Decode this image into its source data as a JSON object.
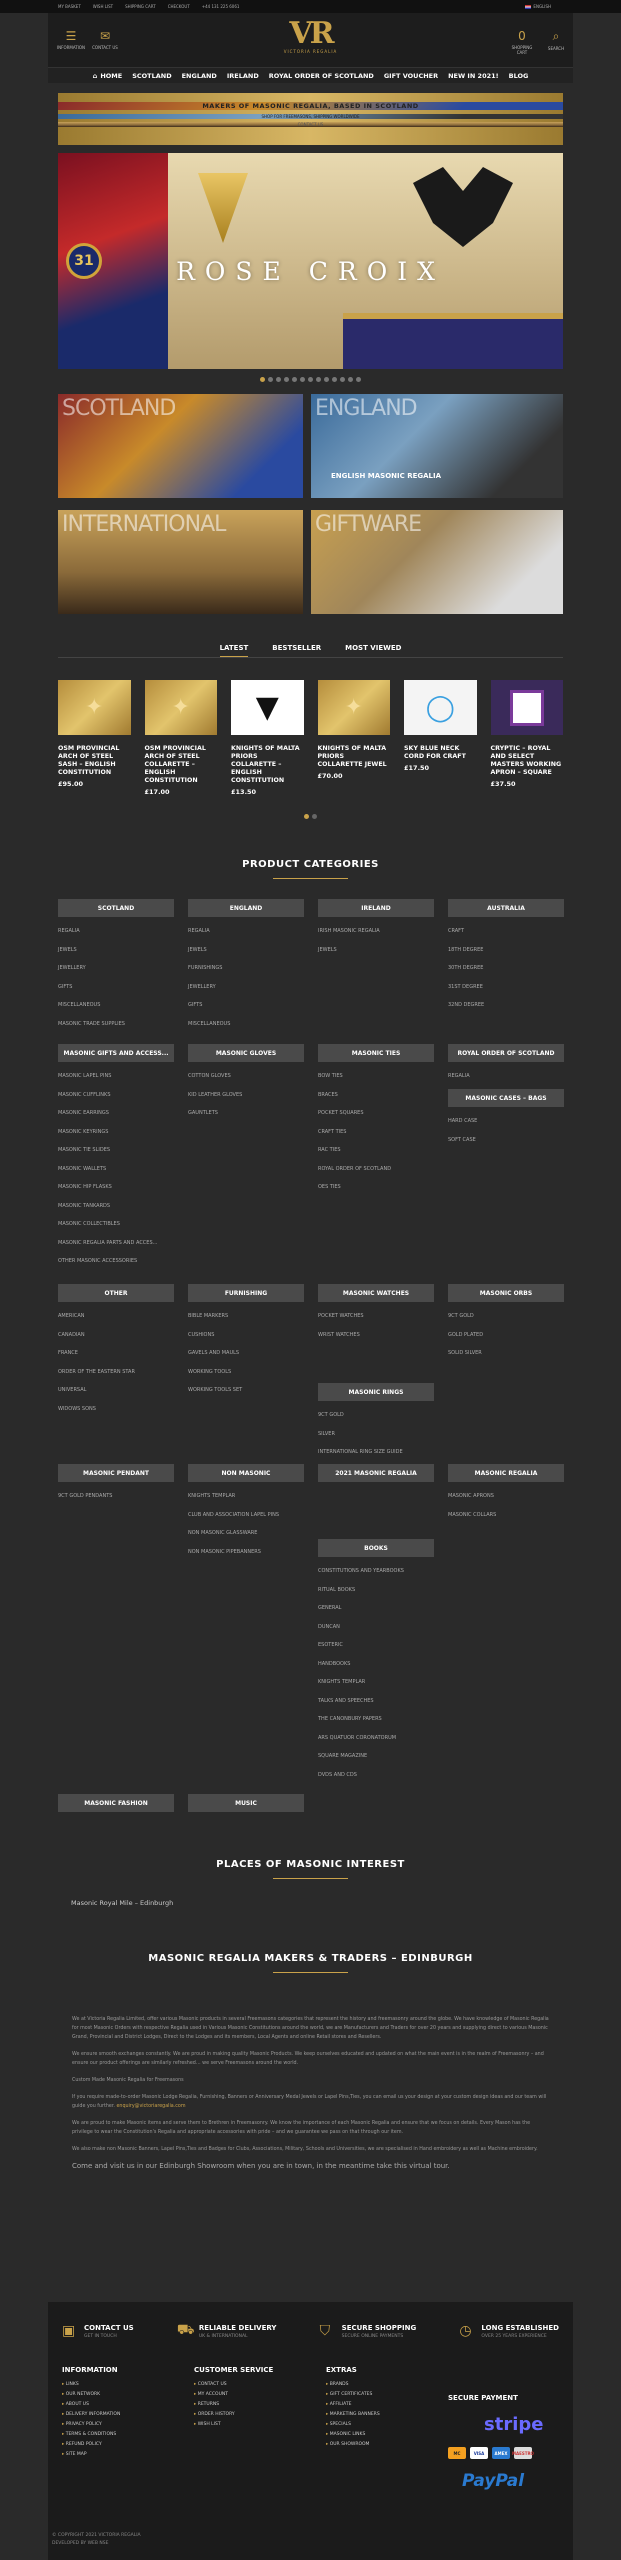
{
  "topbar": {
    "items": [
      "MY BASKET",
      "WISH LIST",
      "SHIPPING CART",
      "CHECKOUT",
      "+44 131 225 6061"
    ],
    "language": "ENGLISH"
  },
  "header": {
    "info_label": "INFORMATION",
    "contact_label": "CONTACT US",
    "logo_text": "VR",
    "logo_sub": "VICTORIA REGALIA",
    "cart_count": "0",
    "cart_label": "SHOPPING CART",
    "search_label": "SEARCH"
  },
  "nav": [
    "HOME",
    "SCOTLAND",
    "ENGLAND",
    "IRELAND",
    "ROYAL ORDER OF SCOTLAND",
    "GIFT VOUCHER",
    "NEW IN 2021!",
    "BLOG"
  ],
  "banner": {
    "title": "MAKERS OF MASONIC REGALIA, BASED IN SCOTLAND",
    "subtitle": "SHOP FOR FREEMASONS, SHIPPING WORLDWIDE",
    "small": "CONTACT US"
  },
  "hero": {
    "caption": "ROSE CROIX",
    "medal": "31",
    "slides": 13,
    "active": 0
  },
  "tiles": [
    {
      "title": "SCOTLAND",
      "caption": ""
    },
    {
      "title": "ENGLAND",
      "caption": "ENGLISH MASONIC REGALIA"
    },
    {
      "title": "INTERNATIONAL",
      "caption": ""
    },
    {
      "title": "GIFTWARE",
      "caption": ""
    }
  ],
  "tabs": [
    "LATEST",
    "BESTSELLER",
    "MOST VIEWED"
  ],
  "products": [
    {
      "name": "OSM PROVINCIAL ARCH OF STEEL SASH – ENGLISH CONSTITUTION",
      "price": "£95.00"
    },
    {
      "name": "OSM PROVINCIAL ARCH OF STEEL COLLARETTE – ENGLISH CONSTITUTION",
      "price": "£17.00"
    },
    {
      "name": "KNIGHTS OF MALTA PRIORS COLLARETTE – ENGLISH CONSTITUTION",
      "price": "£13.50"
    },
    {
      "name": "KNIGHTS OF MALTA PRIORS COLLARETTE JEWEL",
      "price": "£70.00"
    },
    {
      "name": "SKY BLUE NECK CORD FOR CRAFT",
      "price": "£17.50"
    },
    {
      "name": "CRYPTIC – ROYAL AND SELECT MASTERS WORKING APRON – SQUARE",
      "price": "£37.50"
    }
  ],
  "categories_title": "PRODUCT CATEGORIES",
  "categories": [
    {
      "title": "SCOTLAND",
      "items": [
        "REGALIA",
        "JEWELS",
        "JEWELLERY",
        "GIFTS",
        "MISCELLANEOUS",
        "MASONIC TRADE SUPPLIES"
      ]
    },
    {
      "title": "ENGLAND",
      "items": [
        "REGALIA",
        "JEWELS",
        "FURNISHINGS",
        "JEWELLERY",
        "GIFTS",
        "MISCELLANEOUS"
      ]
    },
    {
      "title": "IRELAND",
      "items": [
        "IRISH MASONIC REGALIA",
        "JEWELS"
      ]
    },
    {
      "title": "AUSTRALIA",
      "items": [
        "CRAFT",
        "18TH DEGREE",
        "30TH DEGREE",
        "31ST DEGREE",
        "32ND DEGREE"
      ]
    },
    {
      "title": "MASONIC GIFTS AND ACCESS...",
      "items": [
        "MASONIC LAPEL PINS",
        "MASONIC CUFFLINKS",
        "MASONIC EARRINGS",
        "MASONIC KEYRINGS",
        "MASONIC TIE SLIDES",
        "MASONIC WALLETS",
        "MASONIC HIP FLASKS",
        "MASONIC TANKARDS",
        "MASONIC COLLECTIBLES",
        "MASONIC REGALIA PARTS AND ACCES...",
        "OTHER MASONIC ACCESSORIES"
      ]
    },
    {
      "title": "MASONIC GLOVES",
      "items": [
        "COTTON GLOVES",
        "KID LEATHER GLOVES",
        "GAUNTLETS"
      ]
    },
    {
      "title": "MASONIC TIES",
      "items": [
        "BOW TIES",
        "BRACES",
        "POCKET SQUARES",
        "CRAFT TIES",
        "RAC TIES",
        "ROYAL ORDER OF SCOTLAND",
        "OES TIES"
      ]
    },
    {
      "title": "ROYAL ORDER OF SCOTLAND",
      "items": [
        "REGALIA"
      ]
    },
    {
      "title": "MASONIC CASES – BAGS",
      "items": [
        "HARD CASE",
        "SOFT CASE"
      ]
    },
    {
      "title": "OTHER",
      "items": [
        "AMERICAN",
        "CANADIAN",
        "FRANCE",
        "ORDER OF THE EASTERN STAR",
        "UNIVERSAL",
        "WIDOWS SONS"
      ]
    },
    {
      "title": "FURNISHING",
      "items": [
        "BIBLE MARKERS",
        "CUSHIONS",
        "GAVELS AND MAULS",
        "WORKING TOOLS",
        "WORKING TOOLS SET"
      ]
    },
    {
      "title": "MASONIC WATCHES",
      "items": [
        "POCKET WATCHES",
        "WRIST WATCHES"
      ]
    },
    {
      "title": "MASONIC ORBS",
      "items": [
        "9CT GOLD",
        "GOLD PLATED",
        "SOLID SILVER"
      ]
    },
    {
      "title": "MASONIC RINGS",
      "items": [
        "9CT GOLD",
        "SILVER",
        "INTERNATIONAL RING SIZE GUIDE"
      ]
    },
    {
      "title": "MASONIC PENDANT",
      "items": [
        "9CT GOLD PENDANTS"
      ]
    },
    {
      "title": "NON MASONIC",
      "items": [
        "KNIGHTS TEMPLAR",
        "CLUB AND ASSOCIATION LAPEL PINS",
        "NON MASONIC GLASSWARE",
        "NON MASONIC PIPEBANNERS"
      ]
    },
    {
      "title": "2021 MASONIC REGALIA",
      "items": []
    },
    {
      "title": "MASONIC REGALIA",
      "items": [
        "MASONIC APRONS",
        "MASONIC COLLARS"
      ]
    },
    {
      "title": "BOOKS",
      "items": [
        "CONSTITUTIONS AND YEARBOOKS",
        "RITUAL BOOKS",
        "GENERAL",
        "DUNCAN",
        "ESOTERIC",
        "HANDBOOKS",
        "KNIGHTS TEMPLAR",
        "TALKS AND SPEECHES",
        "THE CANONBURY PAPERS",
        "ARS QUATUOR CORONATORUM",
        "SQUARE MAGAZINE",
        "DVDS AND CDS"
      ]
    },
    {
      "title": "MASONIC FASHION",
      "items": []
    },
    {
      "title": "MUSIC",
      "items": []
    }
  ],
  "places": {
    "title": "PLACES OF MASONIC INTEREST",
    "link": "Masonic Royal Mile – Edinburgh"
  },
  "about": {
    "title": "MASONIC REGALIA MAKERS & TRADERS – EDINBURGH",
    "p1": "We at Victoria Regalia Limited, offer various Masonic products in several Freemasons categories that represent the history and freemasonry around the globe. We have knowledge of Masonic Regalia for most Masonic Orders with respective Regalia used in Various Masonic Constitutions around the world, we are Manufacturers and Traders for over 20 years and supplying direct to various Masonic Grand, Provincial and District Lodges, Direct to the Lodges and its members, Local Agents and online Retail stores and Resellers.",
    "p2": "We ensure smooth exchanges constantly. We are proud in making quality Masonic Products. We keep ourselves educated and updated on what the main event is in the realm of Freemasonry – and ensure our product offerings are similarly refreshed… we serve Freemasons around the world.",
    "p3": "Custom Made Masonic Regalia for Freemasons",
    "p4": "If you require made-to-order Masonic Lodge Regalia, Furnishing, Banners or Anniversary Medal Jewels or Lapel Pins,Ties, you can email us your design at your custom design ideas and our team will guide you further.",
    "email": "enquiry@victoriaregalia.com",
    "p5": "We are proud to make Masonic items and serve them to Brethren in Freemasonry. We know the importance of each Masonic Regalia and ensure that we focus on details. Every Mason has the privilege to wear the Constitution's Regalia and appropriate accessories with pride – and we guarantee we pass on that through our item.",
    "p6": "We also make non Masonic Banners, Lapel Pins,Ties and Badges for Clubs, Associations, Military, Schools and Universities, we are specialised in Hand embroidery as well as Machine embroidery.",
    "p7": "Come and visit us in our Edinburgh Showroom when you are in town, in the meantime take this virtual tour."
  },
  "footer": {
    "features": [
      {
        "title": "CONTACT US",
        "sub": "GET IN TOUCH"
      },
      {
        "title": "RELIABLE DELIVERY",
        "sub": "UK & INTERNATIONAL"
      },
      {
        "title": "SECURE SHOPPING",
        "sub": "SECURE ONLINE PAYMENTS"
      },
      {
        "title": "LONG ESTABLISHED",
        "sub": "OVER 25 YEARS EXPERIENCE"
      }
    ],
    "information": {
      "title": "INFORMATION",
      "items": [
        "LINKS",
        "OUR NETWORK",
        "ABOUT US",
        "DELIVERY INFORMATION",
        "PRIVACY POLICY",
        "TERMS & CONDITIONS",
        "REFUND POLICY",
        "SITE MAP"
      ]
    },
    "service": {
      "title": "CUSTOMER SERVICE",
      "items": [
        "CONTACT US",
        "MY ACCOUNT",
        "RETURNS",
        "ORDER HISTORY",
        "WISH LIST"
      ]
    },
    "extras": {
      "title": "EXTRAS",
      "items": [
        "BRANDS",
        "GIFT CERTIFICATES",
        "AFFILIATE",
        "MARKETING BANNERS",
        "SPECIALS",
        "MASONIC LINKS",
        "OUR SHOWROOM"
      ]
    },
    "payment": {
      "title": "SECURE PAYMENT",
      "stripe": "stripe",
      "paypal": "PayPal",
      "cards": [
        "MC",
        "VISA",
        "AMEX",
        "MAESTRO"
      ]
    },
    "copyright": "© COPYRIGHT 2021 VICTORIA REGALIA",
    "developer": "DEVELOPED BY WEB NSE"
  }
}
